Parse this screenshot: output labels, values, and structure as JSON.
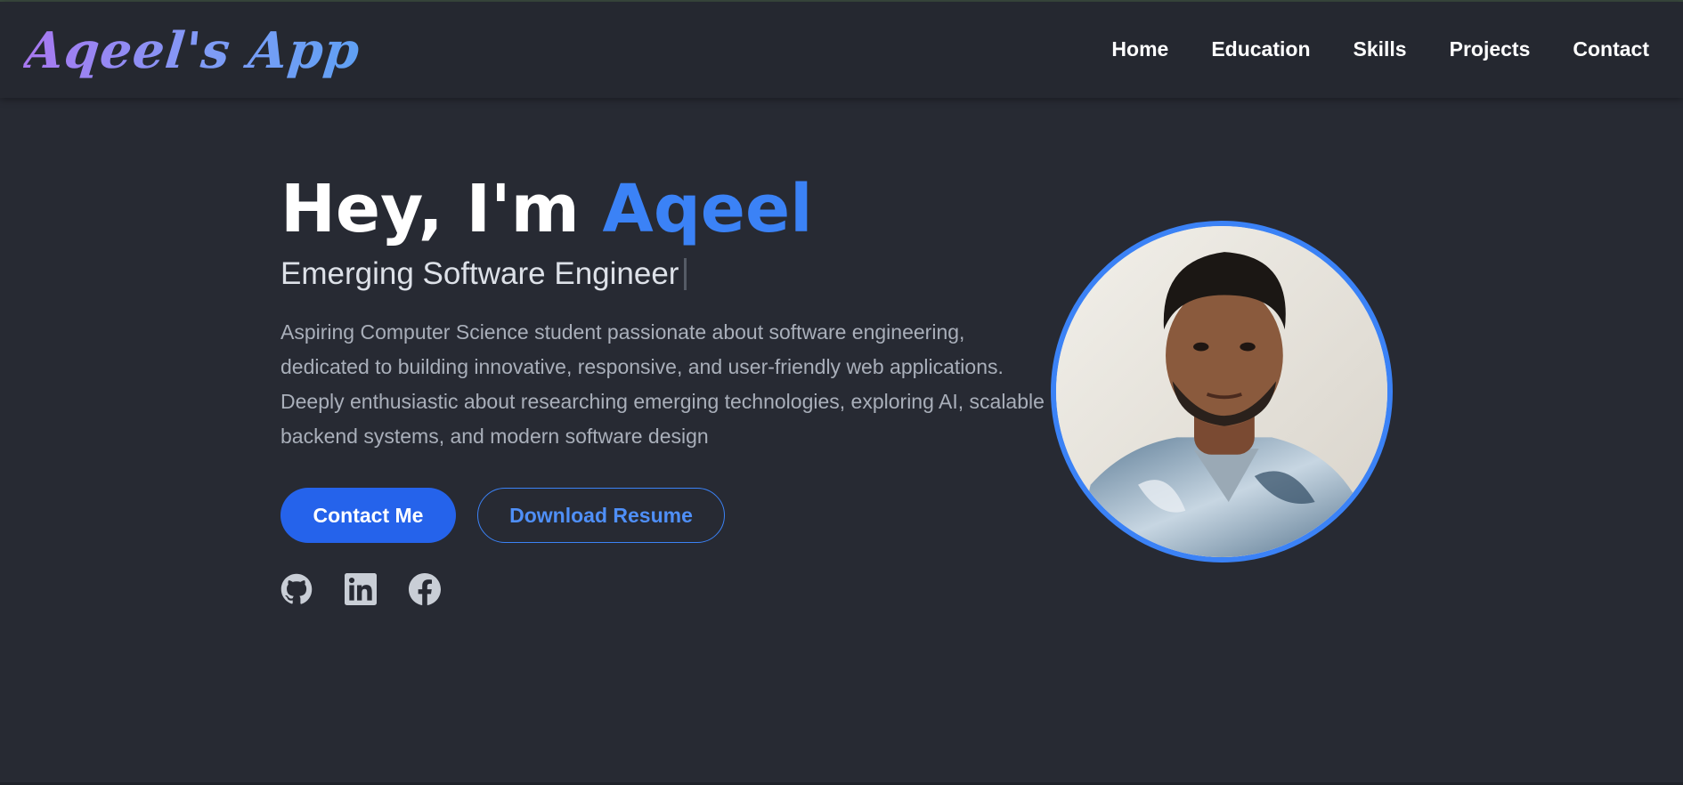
{
  "brand": {
    "title": "Aqeel's App"
  },
  "nav": {
    "items": [
      {
        "label": "Home"
      },
      {
        "label": "Education"
      },
      {
        "label": "Skills"
      },
      {
        "label": "Projects"
      },
      {
        "label": "Contact"
      }
    ]
  },
  "hero": {
    "greeting": "Hey, I'm ",
    "name": "Aqeel",
    "subtitle": "Emerging Software Engineer",
    "description": "Aspiring Computer Science student passionate about software engineering, dedicated to building innovative, responsive, and user-friendly web applications. Deeply enthusiastic about researching emerging technologies, exploring AI, scalable backend systems, and modern software design",
    "buttons": {
      "contact": "Contact Me",
      "resume": "Download Resume"
    },
    "socials": [
      {
        "icon": "github-icon"
      },
      {
        "icon": "linkedin-icon"
      },
      {
        "icon": "facebook-icon"
      }
    ]
  },
  "colors": {
    "background": "#272a33",
    "accent": "#3b82f6",
    "primary_button": "#2563eb"
  }
}
